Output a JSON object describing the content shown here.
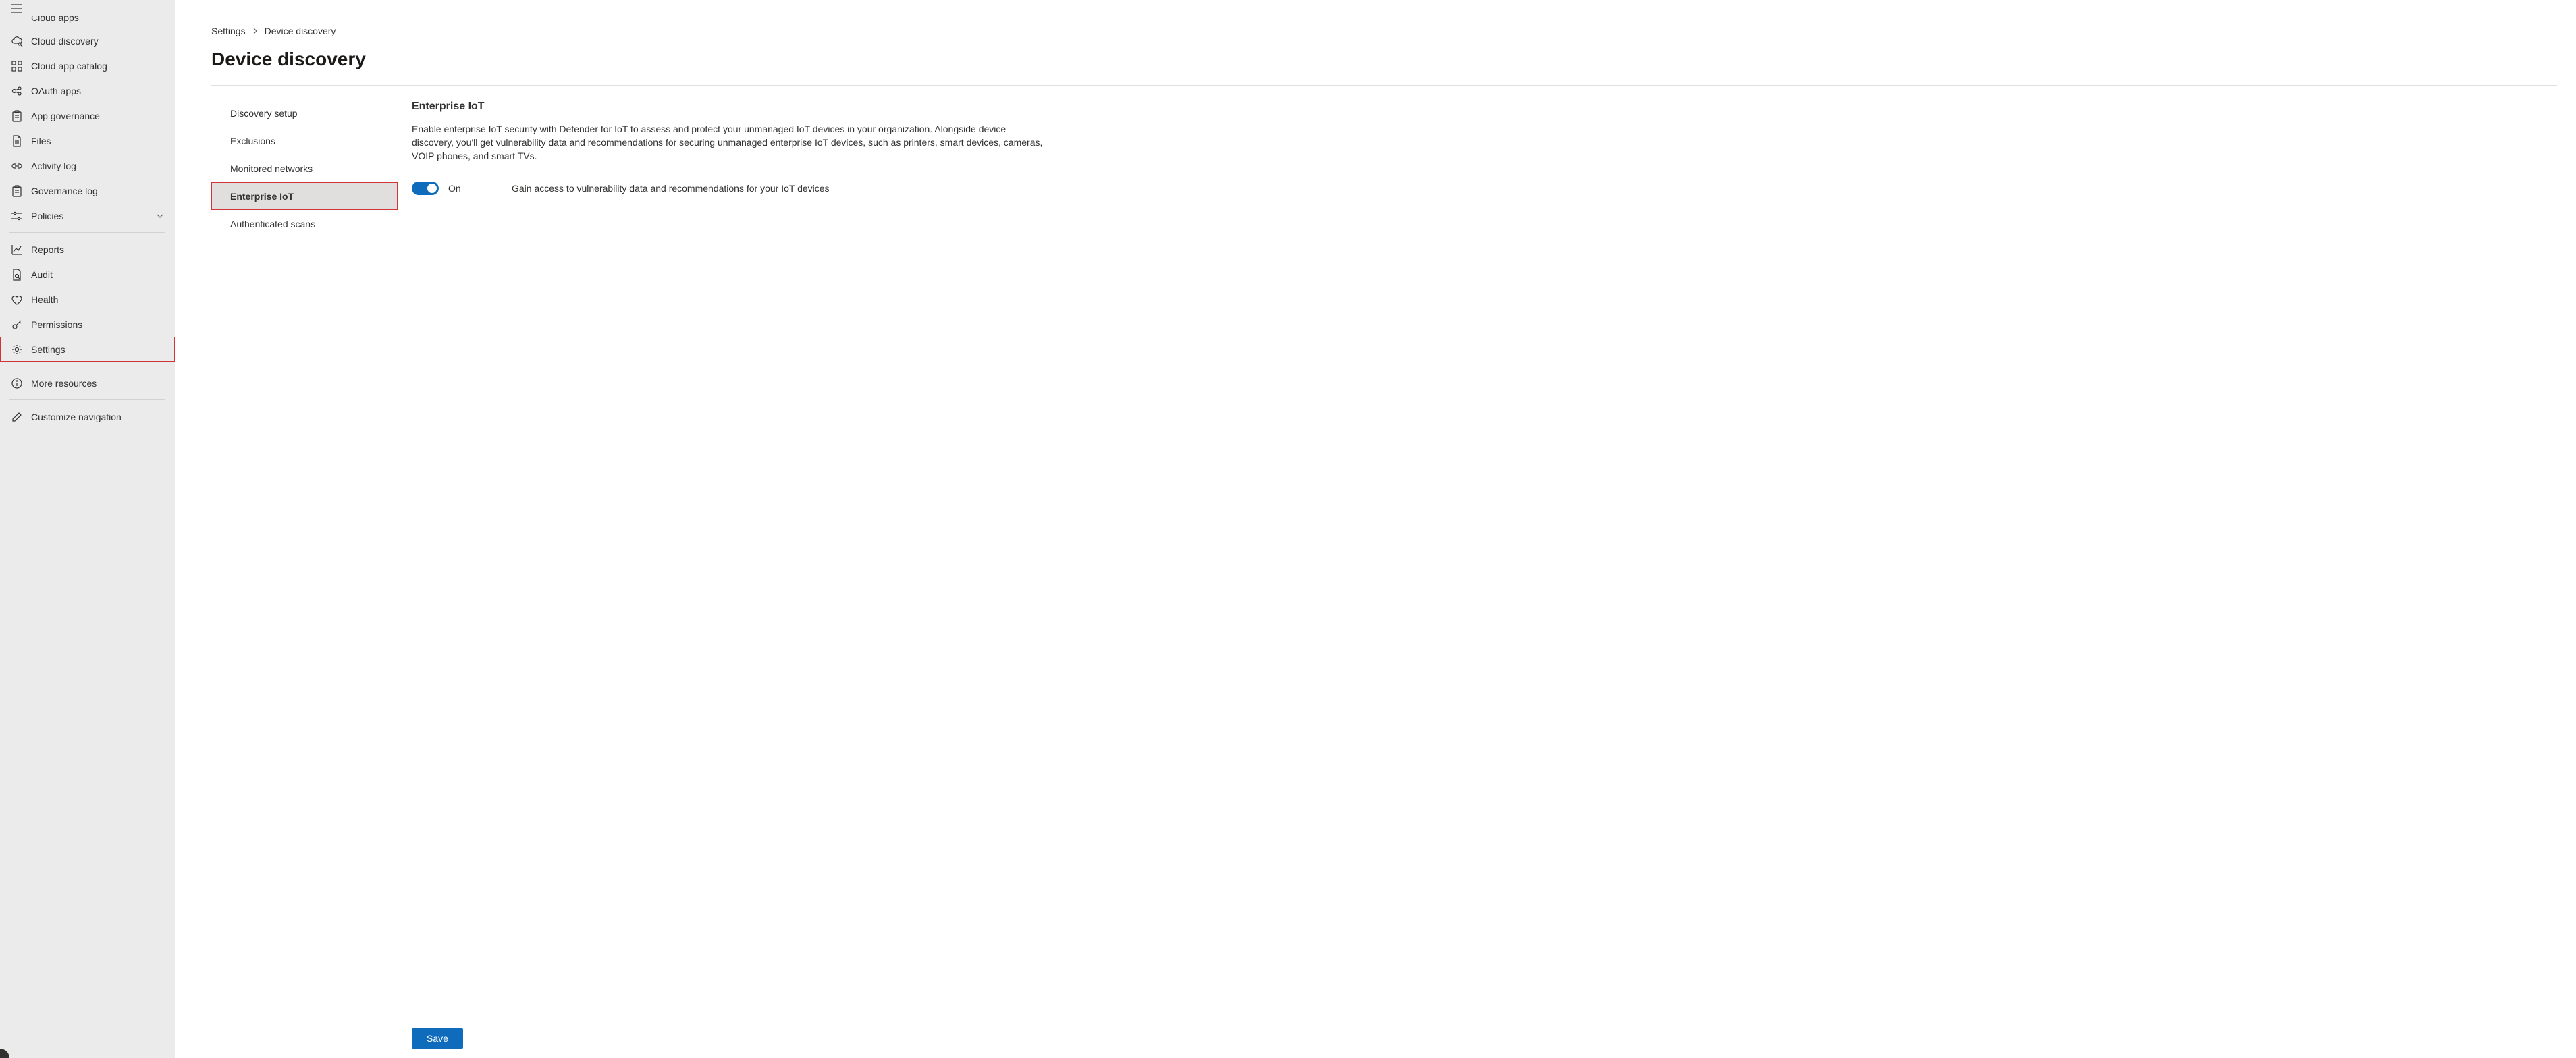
{
  "sidebar": {
    "cut_top_label": "Cloud apps",
    "items": [
      {
        "label": "Cloud discovery",
        "icon": "cloud-discovery-icon"
      },
      {
        "label": "Cloud app catalog",
        "icon": "grid-icon"
      },
      {
        "label": "OAuth apps",
        "icon": "oauth-icon"
      },
      {
        "label": "App governance",
        "icon": "clipboard-icon"
      },
      {
        "label": "Files",
        "icon": "file-icon"
      },
      {
        "label": "Activity log",
        "icon": "link-icon"
      },
      {
        "label": "Governance log",
        "icon": "clipboard-icon"
      },
      {
        "label": "Policies",
        "icon": "sliders-icon",
        "expandable": true
      }
    ],
    "group2": [
      {
        "label": "Reports",
        "icon": "chart-icon"
      },
      {
        "label": "Audit",
        "icon": "audit-icon"
      },
      {
        "label": "Health",
        "icon": "health-icon"
      },
      {
        "label": "Permissions",
        "icon": "key-icon"
      },
      {
        "label": "Settings",
        "icon": "gear-icon",
        "highlighted": true
      }
    ],
    "group3": [
      {
        "label": "More resources",
        "icon": "info-icon"
      }
    ],
    "group4": [
      {
        "label": "Customize navigation",
        "icon": "pencil-icon"
      }
    ]
  },
  "breadcrumb": {
    "root": "Settings",
    "current": "Device discovery"
  },
  "page": {
    "title": "Device discovery"
  },
  "subnav": [
    {
      "label": "Discovery setup"
    },
    {
      "label": "Exclusions"
    },
    {
      "label": "Monitored networks"
    },
    {
      "label": "Enterprise IoT",
      "active": true,
      "highlighted": true
    },
    {
      "label": "Authenticated scans"
    }
  ],
  "panel": {
    "title": "Enterprise IoT",
    "description": "Enable enterprise IoT security with Defender for IoT to assess and protect your unmanaged IoT devices in your organization. Alongside device discovery, you'll get vulnerability data and recommendations for securing unmanaged enterprise IoT devices, such as printers, smart devices, cameras, VOIP phones, and smart TVs.",
    "toggle_state_label": "On",
    "toggle_description": "Gain access to vulnerability data and recommendations for your IoT devices",
    "save_label": "Save"
  }
}
